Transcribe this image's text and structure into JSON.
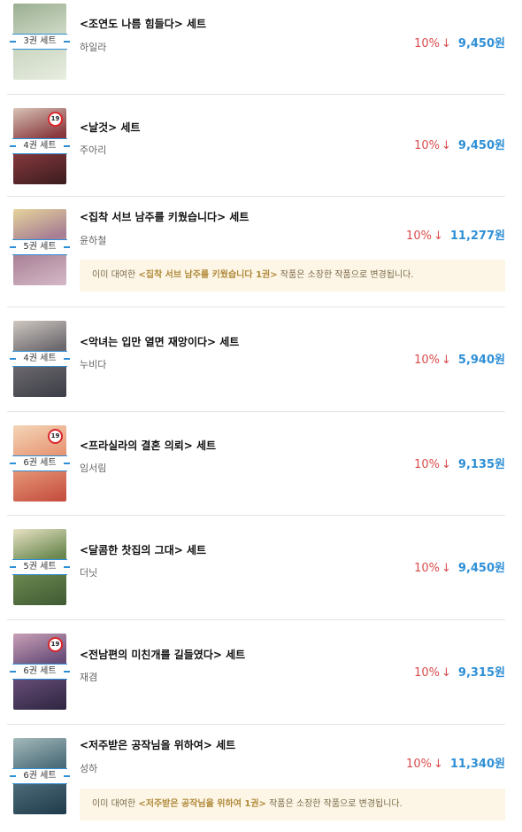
{
  "items": [
    {
      "title": "<조연도 나름 힘들다> 세트",
      "author": "하일라",
      "set_label": "3권 세트",
      "discount": "10%",
      "price": "9,450원",
      "adult": false,
      "cover_colors": [
        "#e8ede0",
        "#c8d4bf",
        "#9aae91"
      ]
    },
    {
      "title": "<날것> 세트",
      "author": "주아리",
      "set_label": "4권 세트",
      "discount": "10%",
      "price": "9,450원",
      "adult": true,
      "adult_label": "19",
      "cover_colors": [
        "#3a1c1e",
        "#8a3a3f",
        "#d7c3b6"
      ]
    },
    {
      "title": "<집착 서브 남주를 키웠습니다> 세트",
      "author": "윤하철",
      "set_label": "5권 세트",
      "discount": "10%",
      "price": "11,277원",
      "adult": false,
      "cover_colors": [
        "#d4b9c8",
        "#a77d93",
        "#e6d49c"
      ],
      "notice": {
        "prefix": "이미 대여한 ",
        "book": "<집착 서브 남주를 키웠습니다 1권>",
        "suffix": " 작품은 소장한 작품으로 변경됩니다."
      }
    },
    {
      "title": "<악녀는 입만 열면 재앙이다> 세트",
      "author": "누비다",
      "set_label": "4권 세트",
      "discount": "10%",
      "price": "5,940원",
      "adult": false,
      "cover_colors": [
        "#3b3d46",
        "#6e6b70",
        "#cfc7c0"
      ]
    },
    {
      "title": "<프라실라의 결혼 의뢰> 세트",
      "author": "임서림",
      "set_label": "6권 세트",
      "discount": "10%",
      "price": "9,135원",
      "adult": true,
      "adult_label": "19",
      "cover_colors": [
        "#c24a3d",
        "#e89a78",
        "#f3d6b8"
      ]
    },
    {
      "title": "<달콤한 찻집의 그대> 세트",
      "author": "더닛",
      "set_label": "5권 세트",
      "discount": "10%",
      "price": "9,450원",
      "adult": false,
      "cover_colors": [
        "#3f5a33",
        "#6d8a51",
        "#e8e2c5"
      ]
    },
    {
      "title": "<전남편의 미친개를 길들였다> 세트",
      "author": "재겸",
      "set_label": "6권 세트",
      "discount": "10%",
      "price": "9,315원",
      "adult": true,
      "adult_label": "19",
      "cover_colors": [
        "#2d2540",
        "#6a4f7a",
        "#c9a0b6"
      ]
    },
    {
      "title": "<저주받은 공작님을 위하여> 세트",
      "author": "성하",
      "set_label": "6권 세트",
      "discount": "10%",
      "price": "11,340원",
      "adult": false,
      "cover_colors": [
        "#1f3a4a",
        "#4f6f7c",
        "#a3b9b9"
      ],
      "notice": {
        "prefix": "이미 대여한 ",
        "book": "<저주받은 공작님을 위하여 1권>",
        "suffix": " 작품은 소장한 작품으로 변경됩니다."
      }
    }
  ],
  "colors": {
    "accent_blue": "#2e8fd6",
    "discount_red": "#d94b4b",
    "adult_red": "#d9262b",
    "notice_bg": "#fdf6e6"
  }
}
